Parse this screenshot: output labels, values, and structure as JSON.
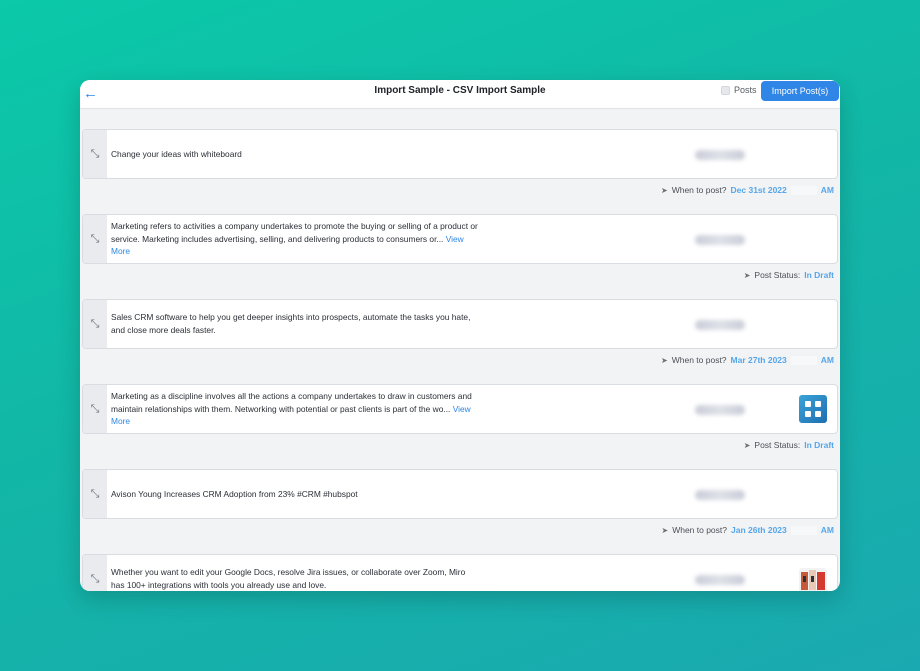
{
  "header": {
    "title": "Import Sample - CSV Import Sample",
    "posts_label": "Posts",
    "import_button": "Import Post(s)"
  },
  "posts": [
    {
      "text": "Change your ideas with whiteboard",
      "view_more": "",
      "meta": {
        "label": "When to post?",
        "value": "Dec 31st 2022",
        "ampm": "AM"
      }
    },
    {
      "text": "Marketing refers to activities a company undertakes to promote the buying or selling of a product or service. Marketing includes advertising, selling, and delivering products to consumers or...",
      "view_more": "View More",
      "meta": {
        "label": "Post Status:",
        "value": "In Draft",
        "ampm": ""
      }
    },
    {
      "text": "Sales CRM software to help you get deeper insights into prospects, automate the tasks you hate, and close more deals faster.",
      "view_more": "",
      "meta": {
        "label": "When to post?",
        "value": "Mar 27th 2023",
        "ampm": "AM"
      }
    },
    {
      "text": "Marketing as a discipline involves all the actions a company undertakes to draw in customers and maintain relationships with them. Networking with potential or past clients is part of the wo...",
      "view_more": "View More",
      "meta": {
        "label": "Post Status:",
        "value": "In Draft",
        "ampm": ""
      }
    },
    {
      "text": "Avison Young Increases CRM Adoption from 23% #CRM #hubspot",
      "view_more": "",
      "meta": {
        "label": "When to post?",
        "value": "Jan 26th 2023",
        "ampm": "AM"
      }
    },
    {
      "text": "Whether you want to edit your Google Docs, resolve Jira issues, or collaborate over Zoom, Miro has 100+ integrations with tools you already use and love.",
      "view_more": "",
      "meta": null
    }
  ],
  "icons": {
    "back": "arrow-left-icon",
    "expand": "expand-icon",
    "send": "send-icon"
  },
  "colors": {
    "accent": "#2f86e6",
    "link_value": "#56a6ea"
  }
}
